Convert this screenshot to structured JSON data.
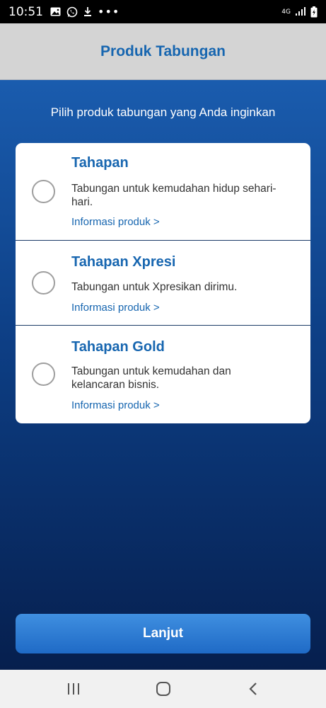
{
  "status_bar": {
    "time": "10:51",
    "dots": "•••",
    "network": "4G"
  },
  "header": {
    "title": "Produk Tabungan"
  },
  "main": {
    "subtitle": "Pilih produk tabungan yang Anda inginkan",
    "options": [
      {
        "title": "Tahapan",
        "description": "Tabungan untuk kemudahan hidup sehari-hari.",
        "link": "Informasi produk >"
      },
      {
        "title": "Tahapan Xpresi",
        "description": "Tabungan untuk Xpresikan dirimu.",
        "link": "Informasi produk >"
      },
      {
        "title": "Tahapan Gold",
        "description": "Tabungan untuk kemudahan dan kelancaran bisnis.",
        "link": "Informasi produk >"
      }
    ],
    "next_label": "Lanjut"
  },
  "colors": {
    "accent": "#1766b0",
    "header_bg": "#d4d4d4",
    "gradient_top": "#1a5cae",
    "gradient_bottom": "#061f4e",
    "button": "#2a7bd4"
  },
  "icons": {
    "status_left": [
      "image-icon",
      "whatsapp-icon",
      "download-icon"
    ],
    "status_right": [
      "network-4g-icon",
      "signal-icon",
      "battery-charging-icon"
    ],
    "nav": [
      "recent-apps-icon",
      "home-icon",
      "back-icon"
    ]
  }
}
